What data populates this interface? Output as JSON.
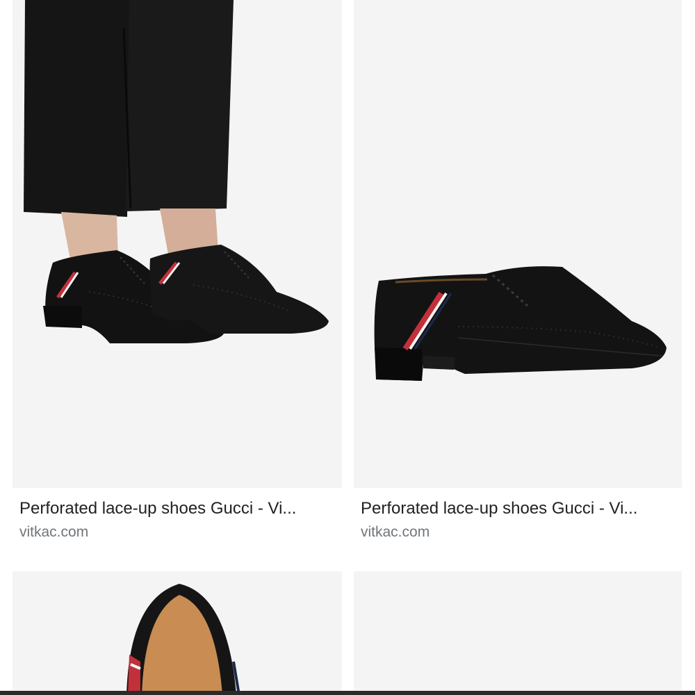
{
  "results": [
    {
      "title": "Perforated lace-up shoes Gucci - Vi...",
      "source": "vitkac.com",
      "image": "shoes-worn-on-feet"
    },
    {
      "title": "Perforated lace-up shoes Gucci - Vi...",
      "source": "vitkac.com",
      "image": "single-shoe-side-view"
    },
    {
      "title": "",
      "source": "",
      "image": "shoe-top-view"
    },
    {
      "title": "",
      "source": "",
      "image": "empty-placeholder"
    }
  ],
  "colors": {
    "thumb_background": "#f4f4f4",
    "title_text": "#202124",
    "source_text": "#70757a",
    "stripe_red": "#c2303a",
    "stripe_white": "#f3f3f3",
    "stripe_navy": "#1c2a4a"
  }
}
